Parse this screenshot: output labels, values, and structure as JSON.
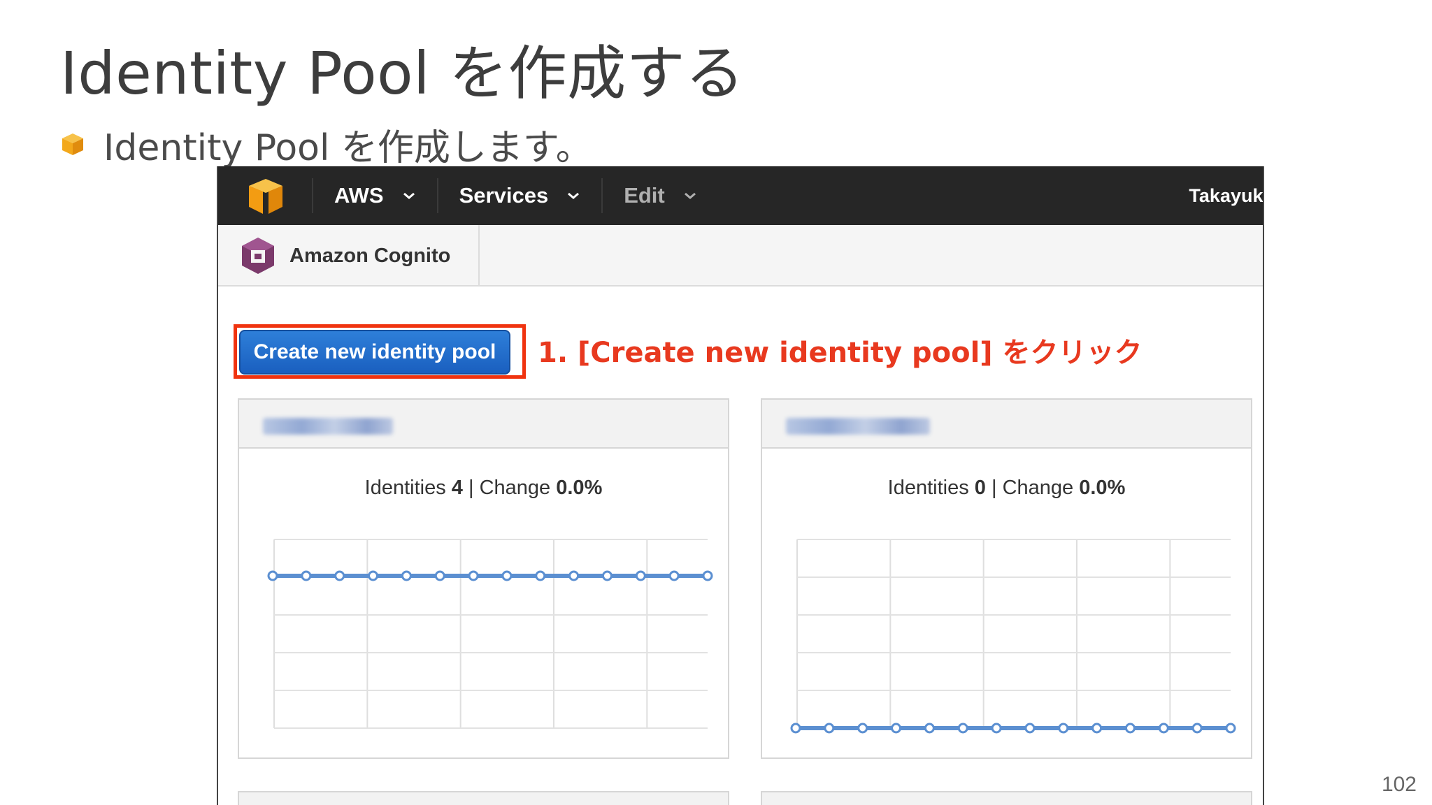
{
  "slide": {
    "title": "Identity Pool を作成する",
    "bullet": "Identity Pool を作成します。",
    "page_number": "102"
  },
  "topbar": {
    "nav": [
      {
        "label": "AWS"
      },
      {
        "label": "Services"
      },
      {
        "label": "Edit"
      }
    ],
    "user": "Takayuki"
  },
  "service": {
    "name": "Amazon Cognito"
  },
  "actions": {
    "create_label": "Create new identity pool"
  },
  "annotation": "1. [Create new identity pool] をクリック",
  "pools": [
    {
      "identities_label": "Identities",
      "identities": "4",
      "sep": "|",
      "change_label": "Change",
      "change": "0.0%"
    },
    {
      "identities_label": "Identities",
      "identities": "0",
      "sep": "|",
      "change_label": "Change",
      "change": "0.0%"
    }
  ],
  "chart_data": [
    {
      "type": "line",
      "series": [
        {
          "values": [
            4,
            4,
            4,
            4,
            4,
            4,
            4,
            4,
            4,
            4,
            4,
            4,
            4,
            4
          ]
        }
      ],
      "ylim": [
        0,
        5
      ],
      "grid": true,
      "color": "#5b8fd1"
    },
    {
      "type": "line",
      "series": [
        {
          "values": [
            0,
            0,
            0,
            0,
            0,
            0,
            0,
            0,
            0,
            0,
            0,
            0,
            0,
            0
          ]
        }
      ],
      "ylim": [
        0,
        1
      ],
      "grid": true,
      "color": "#5b8fd1"
    }
  ],
  "colors": {
    "topbar": "#262626",
    "primary_button": "#1f6fcf",
    "highlight": "#f0330f",
    "annotation": "#e8391f",
    "bullet_icon": "#f3a81b"
  }
}
